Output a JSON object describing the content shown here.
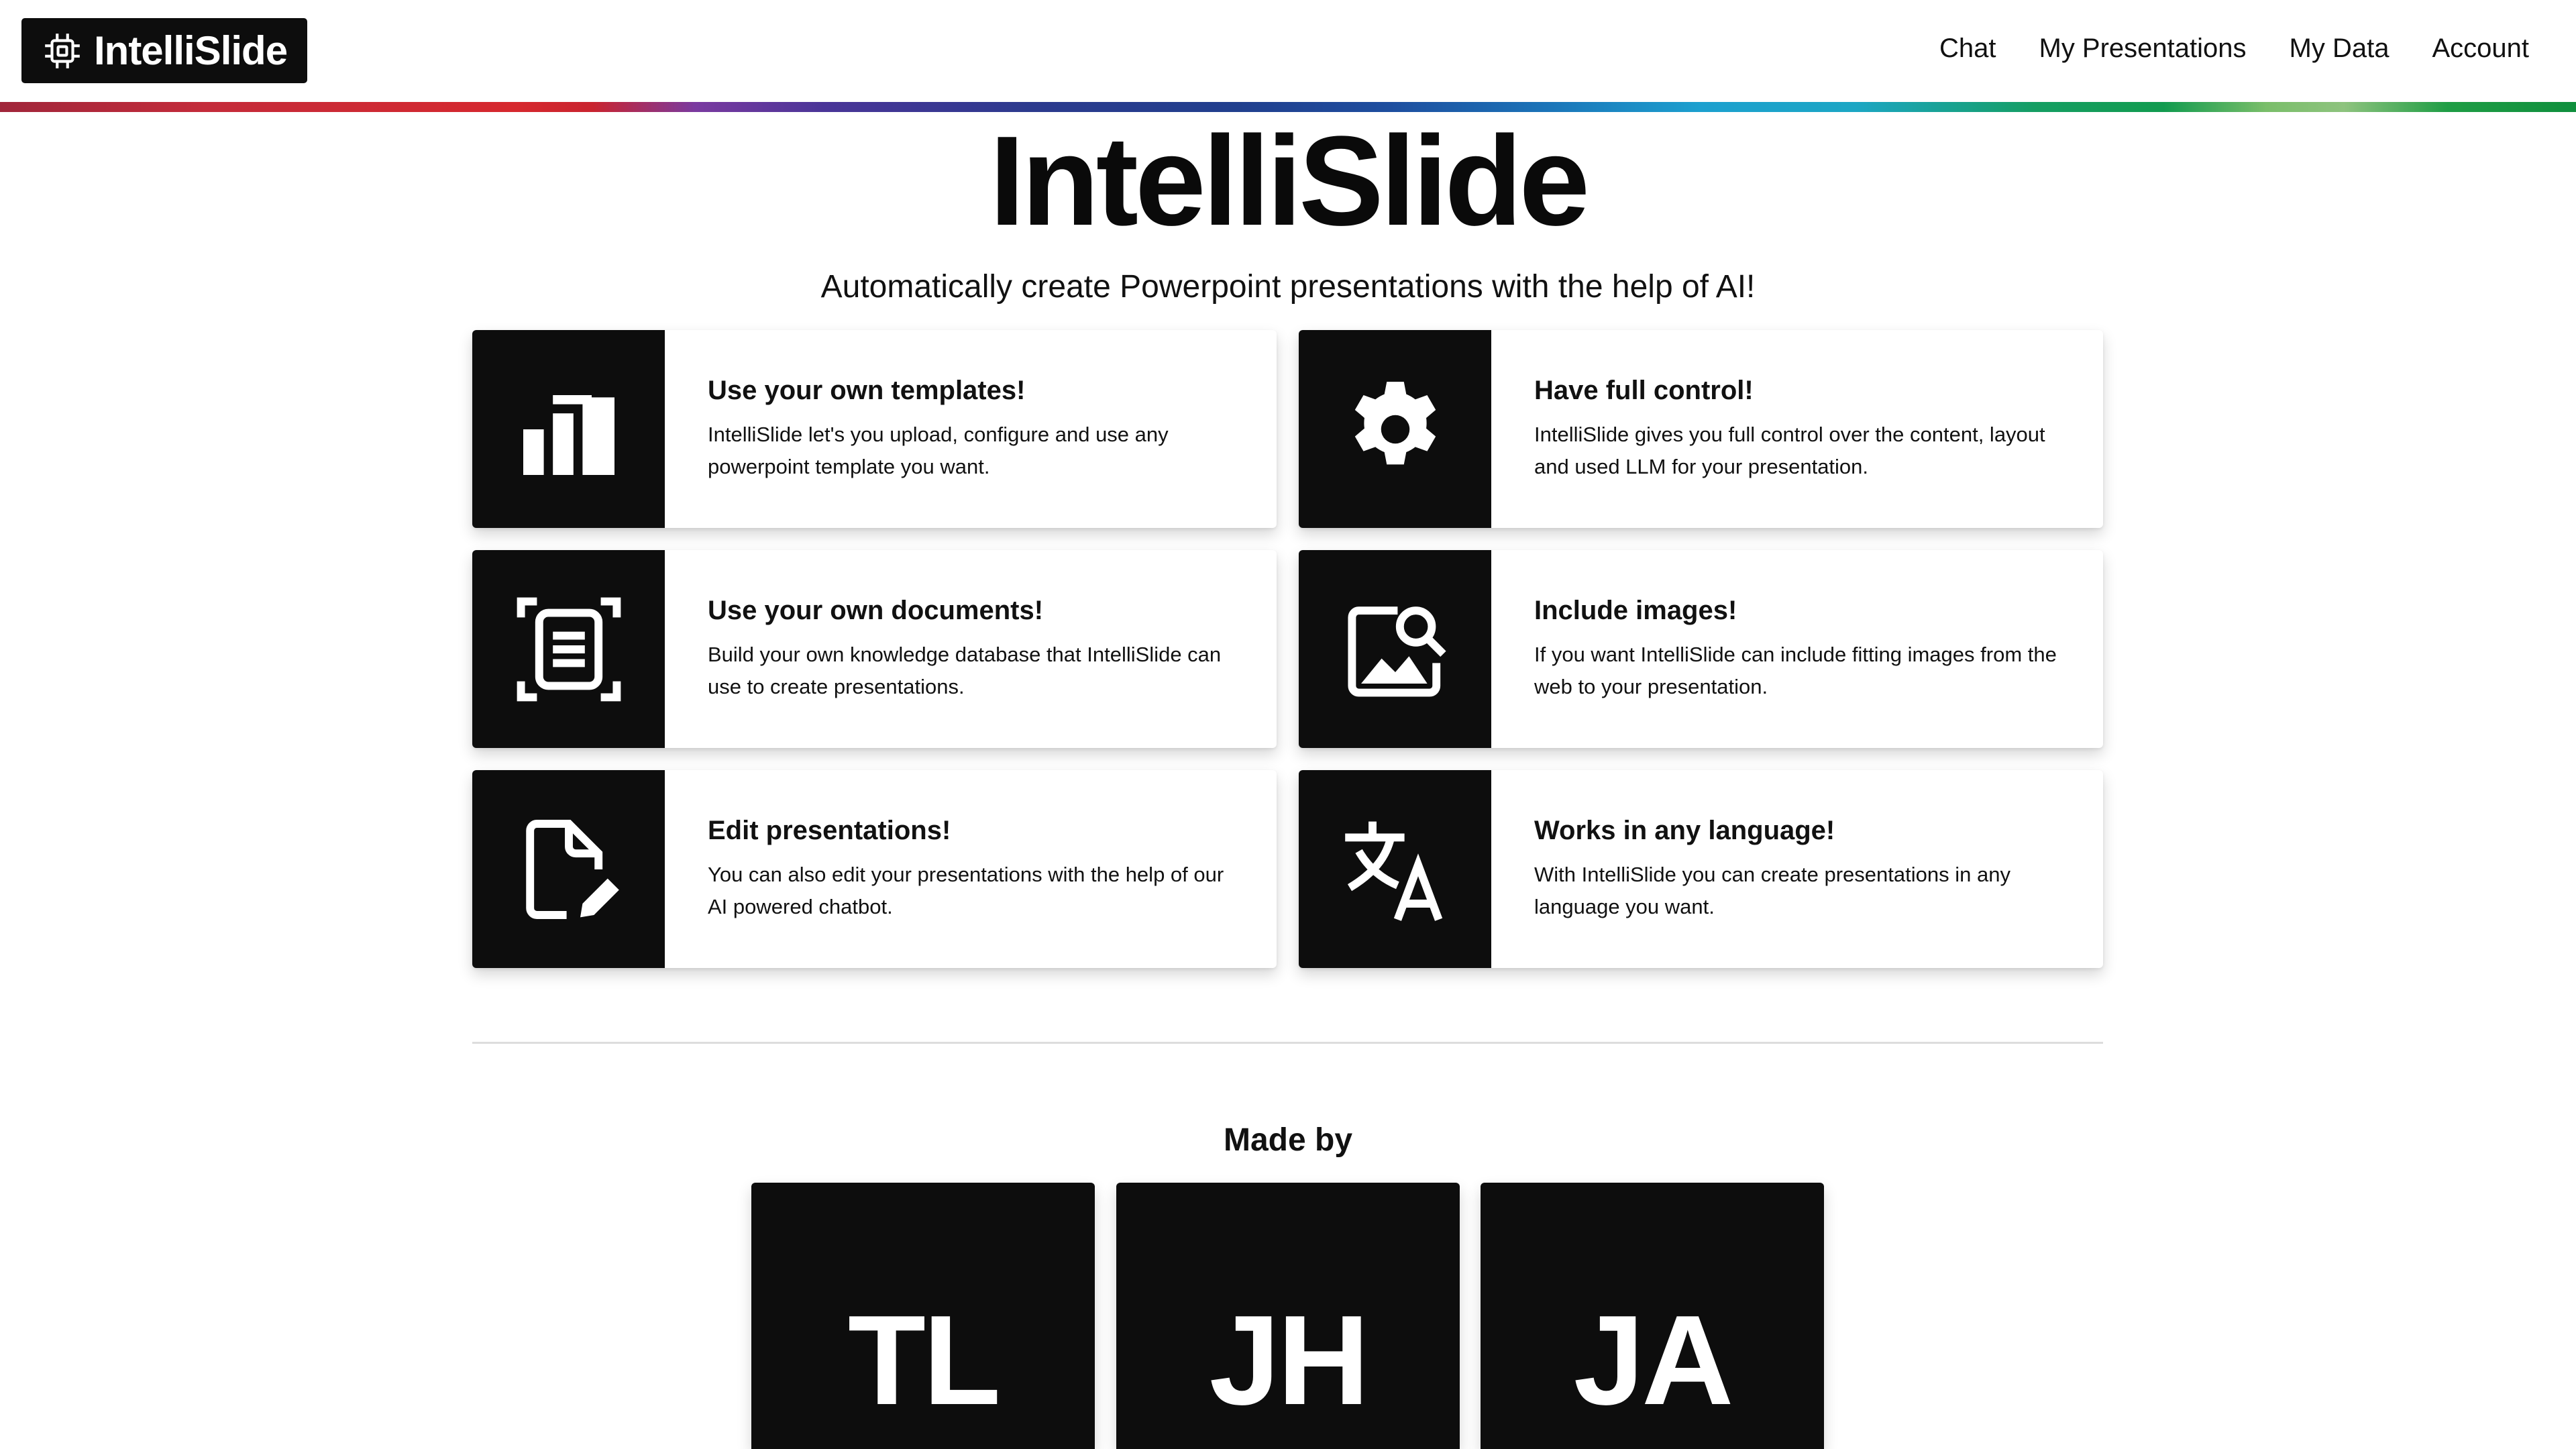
{
  "header": {
    "logo_text": "IntelliSlide",
    "logo_icon": "cpu-chip-icon",
    "nav": [
      {
        "label": "Chat"
      },
      {
        "label": "My Presentations"
      },
      {
        "label": "My Data"
      },
      {
        "label": "Account"
      }
    ]
  },
  "hero": {
    "title": "IntelliSlide",
    "subtitle": "Automatically create Powerpoint presentations with the help of AI!"
  },
  "features": [
    {
      "icon": "bar-chart-icon",
      "title": "Use your own templates!",
      "description": "IntelliSlide let's you upload, configure and use any powerpoint template you want."
    },
    {
      "icon": "gear-icon",
      "title": "Have full control!",
      "description": "IntelliSlide gives you full control over the content, layout and used LLM for your presentation."
    },
    {
      "icon": "document-scan-icon",
      "title": "Use your own documents!",
      "description": "Build your own knowledge database that IntelliSlide can use to create presentations."
    },
    {
      "icon": "image-search-icon",
      "title": "Include images!",
      "description": "If you want IntelliSlide can include fitting images from the web to your presentation."
    },
    {
      "icon": "file-edit-icon",
      "title": "Edit presentations!",
      "description": "You can also edit your presentations with the help of our AI powered chatbot."
    },
    {
      "icon": "translate-icon",
      "title": "Works in any language!",
      "description": "With IntelliSlide you can create presentations in any language you want."
    }
  ],
  "made_by": {
    "heading": "Made by",
    "authors": [
      {
        "initials": "TL"
      },
      {
        "initials": "JH"
      },
      {
        "initials": "JA"
      }
    ]
  },
  "colors": {
    "dark": "#0d0d0d",
    "background": "#ffffff"
  }
}
